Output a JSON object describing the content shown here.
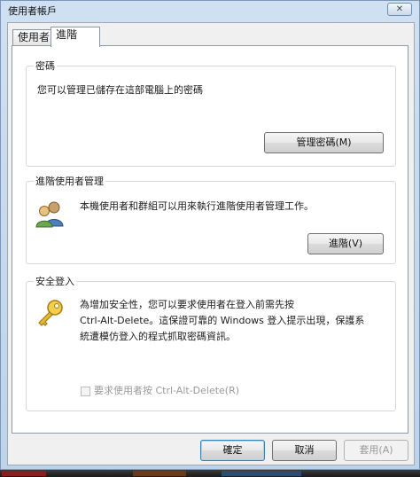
{
  "window": {
    "title": "使用者帳戶",
    "close_glyph": "✕"
  },
  "tabs": [
    {
      "label": "使用者"
    },
    {
      "label": "進階"
    }
  ],
  "passwords": {
    "label": "密碼",
    "description": "您可以管理已儲存在這部電腦上的密碼",
    "manage_button": "管理密碼(M)"
  },
  "advanced_user_management": {
    "label": "進階使用者管理",
    "description": "本機使用者和群組可以用來執行進階使用者管理工作。",
    "advanced_button": "進階(V)",
    "icon": "users-icon"
  },
  "secure_logon": {
    "label": "安全登入",
    "description_lines": [
      "為增加安全性，您可以要求使用者在登入前需先按",
      "Ctrl-Alt-Delete。這保證可靠的 Windows 登入提示出現，保護系",
      "統遭模仿登入的程式抓取密碼資訊。"
    ],
    "checkbox_label": "要求使用者按 Ctrl-Alt-Delete(R)",
    "checkbox_checked": false,
    "icon": "key-icon"
  },
  "footer": {
    "ok": "確定",
    "cancel": "取消",
    "apply": "套用(A)"
  },
  "colors": {
    "accent_border": "#3c7fb1",
    "disabled_text": "#9a9a9a",
    "window_frame": "#bcd3ea"
  }
}
